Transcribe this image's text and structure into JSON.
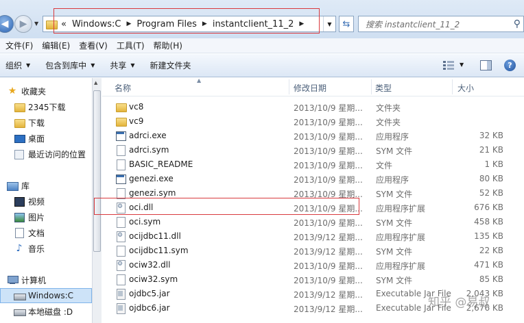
{
  "address": {
    "breadcrumbs": [
      "Windows:C",
      "Program Files",
      "instantclient_11_2"
    ],
    "overflow": "«",
    "search_placeholder": "搜索 instantclient_11_2"
  },
  "menu": [
    "文件(F)",
    "编辑(E)",
    "查看(V)",
    "工具(T)",
    "帮助(H)"
  ],
  "toolbar": {
    "organize": "组织",
    "include_library": "包含到库中",
    "share": "共享",
    "new_folder": "新建文件夹"
  },
  "nav": {
    "favorites": "收藏夹",
    "fav_items": [
      "2345下载",
      "下载",
      "桌面",
      "最近访问的位置"
    ],
    "libraries": "库",
    "lib_items": [
      "视频",
      "图片",
      "文档",
      "音乐"
    ],
    "computer": "计算机",
    "drives": [
      "Windows:C",
      "本地磁盘 :D"
    ]
  },
  "columns": {
    "name": "名称",
    "date": "修改日期",
    "type": "类型",
    "size": "大小"
  },
  "files": [
    {
      "name": "vc8",
      "date": "2013/10/9 星期...",
      "type": "文件夹",
      "size": "",
      "icon": "folder-icon"
    },
    {
      "name": "vc9",
      "date": "2013/10/9 星期...",
      "type": "文件夹",
      "size": "",
      "icon": "folder-icon"
    },
    {
      "name": "adrci.exe",
      "date": "2013/10/9 星期...",
      "type": "应用程序",
      "size": "32 KB",
      "icon": "exe-icon"
    },
    {
      "name": "adrci.sym",
      "date": "2013/10/9 星期...",
      "type": "SYM 文件",
      "size": "21 KB",
      "icon": "file-icon"
    },
    {
      "name": "BASIC_README",
      "date": "2013/10/9 星期...",
      "type": "文件",
      "size": "1 KB",
      "icon": "file-icon"
    },
    {
      "name": "genezi.exe",
      "date": "2013/10/9 星期...",
      "type": "应用程序",
      "size": "80 KB",
      "icon": "exe-icon"
    },
    {
      "name": "genezi.sym",
      "date": "2013/10/9 星期...",
      "type": "SYM 文件",
      "size": "52 KB",
      "icon": "file-icon"
    },
    {
      "name": "oci.dll",
      "date": "2013/10/9 星期...",
      "type": "应用程序扩展",
      "size": "676 KB",
      "icon": "dll-icon"
    },
    {
      "name": "oci.sym",
      "date": "2013/10/9 星期...",
      "type": "SYM 文件",
      "size": "458 KB",
      "icon": "file-icon"
    },
    {
      "name": "ocijdbc11.dll",
      "date": "2013/9/12 星期...",
      "type": "应用程序扩展",
      "size": "135 KB",
      "icon": "dll-icon"
    },
    {
      "name": "ocijdbc11.sym",
      "date": "2013/9/12 星期...",
      "type": "SYM 文件",
      "size": "22 KB",
      "icon": "file-icon"
    },
    {
      "name": "ociw32.dll",
      "date": "2013/10/9 星期...",
      "type": "应用程序扩展",
      "size": "471 KB",
      "icon": "dll-icon"
    },
    {
      "name": "ociw32.sym",
      "date": "2013/10/9 星期...",
      "type": "SYM 文件",
      "size": "85 KB",
      "icon": "file-icon"
    },
    {
      "name": "ojdbc5.jar",
      "date": "2013/9/12 星期...",
      "type": "Executable Jar File",
      "size": "2,043 KB",
      "icon": "jar-icon"
    },
    {
      "name": "ojdbc6.jar",
      "date": "2013/9/12 星期...",
      "type": "Executable Jar File",
      "size": "2,676 KB",
      "icon": "jar-icon"
    }
  ],
  "watermark": "知乎 @易叔",
  "colors": {
    "highlight": "#d9393d",
    "selection": "#cde3f8"
  }
}
